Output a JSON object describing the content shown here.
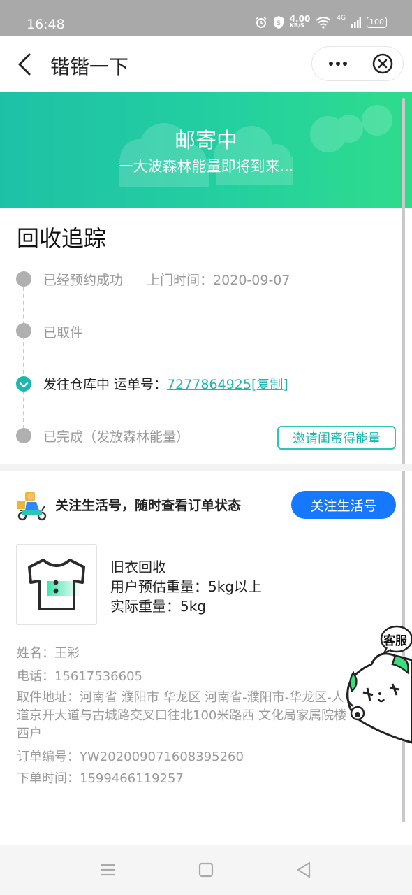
{
  "status_bar": {
    "time": "16:48",
    "net_speed": "4.00",
    "net_unit": "KB/S",
    "network": "4G",
    "battery": "100"
  },
  "nav": {
    "title": "锴锴一下"
  },
  "banner": {
    "title": "邮寄中",
    "subtitle": "一大波森林能量即将到来..."
  },
  "tracking": {
    "title": "回收追踪",
    "steps": [
      {
        "label": "已经预约成功",
        "extra": "上门时间：2020-09-07",
        "active": false
      },
      {
        "label": "已取件",
        "active": false
      },
      {
        "label": "发往仓库中 运单号：",
        "waybill": "7277864925",
        "copy": "[复制]",
        "active": true
      },
      {
        "label": "已完成（发放森林能量）",
        "active": false
      }
    ],
    "invite_button": "邀请闺蜜得能量"
  },
  "follow": {
    "text": "关注生活号，随时查看订单状态",
    "button": "关注生活号"
  },
  "product": {
    "name": "旧衣回收",
    "estimate": "用户预估重量：5kg以上",
    "actual": "实际重量：5kg"
  },
  "order_info": {
    "name": "姓名：王彩",
    "phone": "电话：15617536605",
    "address": "取件地址：河南省 濮阳市 华龙区 河南省-濮阳市-华龙区-人道京开大道与古城路交叉口往北100米路西 文化局家属院楼西户",
    "order_no": "订单编号：YW202009071608395260",
    "order_time": "下单时间：1599466119257"
  },
  "customer_service": {
    "label": "客服"
  },
  "colors": {
    "accent": "#1bb8b0",
    "banner_start": "#1ec1a6",
    "banner_end": "#2fdc8c",
    "primary_button": "#1677ff"
  }
}
